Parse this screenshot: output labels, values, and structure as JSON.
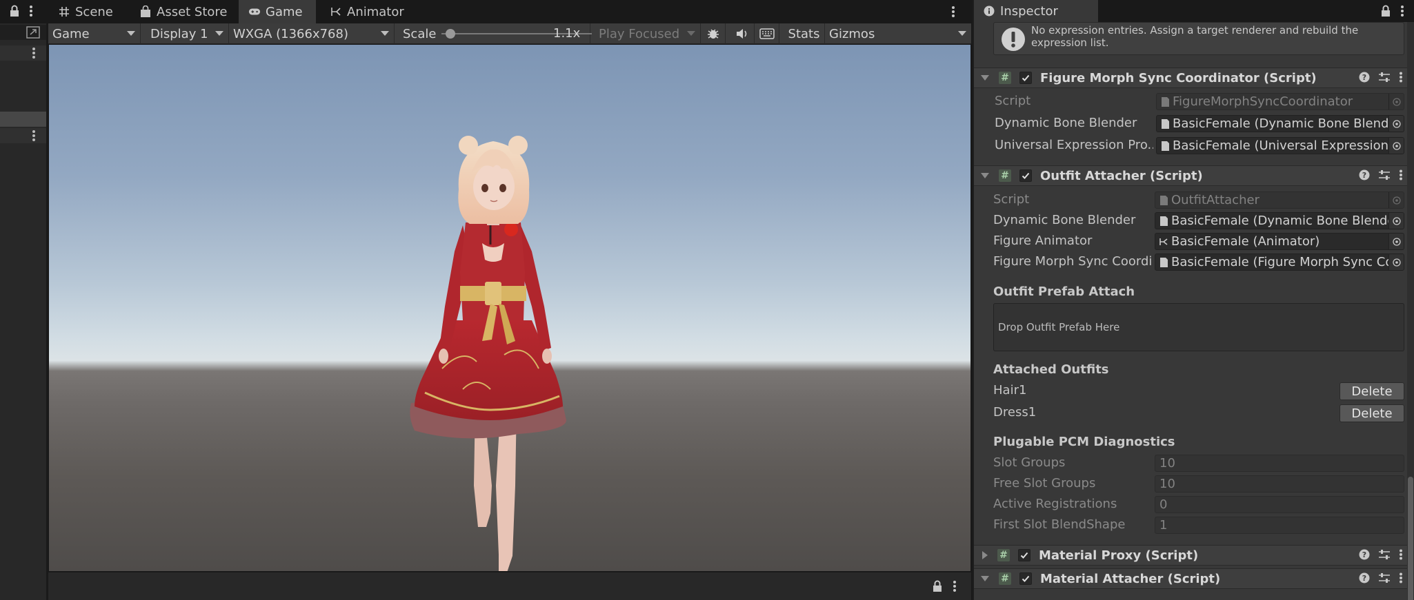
{
  "tabs": {
    "scene": "Scene",
    "asset_store": "Asset Store",
    "game": "Game",
    "animator": "Animator",
    "inspector": "Inspector"
  },
  "toolbar": {
    "view_mode": "Game",
    "display": "Display 1",
    "resolution": "WXGA (1366x768)",
    "scale_label": "Scale",
    "scale_value": "1.1x",
    "scale_fraction": 0.03,
    "play_mode": "Play Focused",
    "stats": "Stats",
    "gizmos": "Gizmos"
  },
  "inspector": {
    "help_text": "No expression entries. Assign a target renderer and rebuild the expression list.",
    "figure_morph": {
      "title": "Figure Morph Sync Coordinator (Script)",
      "rows": [
        {
          "label": "Script",
          "value": "FigureMorphSyncCoordinator"
        },
        {
          "label": "Dynamic Bone Blender",
          "value": "BasicFemale (Dynamic Bone Blender)"
        },
        {
          "label": "Universal Expression Pro...",
          "value": "BasicFemale (Universal Expression Pro)"
        }
      ]
    },
    "outfit_attacher": {
      "title": "Outfit Attacher (Script)",
      "rows": [
        {
          "label": "Script",
          "value": "OutfitAttacher"
        },
        {
          "label": "Dynamic Bone Blender",
          "value": "BasicFemale (Dynamic Bone Blender)"
        },
        {
          "label": "Figure Animator",
          "value": "BasicFemale (Animator)"
        },
        {
          "label": "Figure Morph Sync Coordin",
          "value": "BasicFemale (Figure Morph Sync Coordinator)"
        }
      ],
      "prefab_attach_title": "Outfit Prefab Attach",
      "drop_text": "Drop Outfit Prefab Here",
      "attached_title": "Attached Outfits",
      "attached": [
        {
          "name": "Hair1",
          "action": "Delete"
        },
        {
          "name": "Dress1",
          "action": "Delete"
        }
      ],
      "diagnostics_title": "Plugable PCM Diagnostics",
      "diagnostics": [
        {
          "label": "Slot Groups",
          "value": "10"
        },
        {
          "label": "Free Slot Groups",
          "value": "10"
        },
        {
          "label": "Active Registrations",
          "value": "0"
        },
        {
          "label": "First Slot BlendShape",
          "value": "1"
        }
      ]
    },
    "material_proxy": {
      "title": "Material Proxy (Script)"
    },
    "material_attacher": {
      "title": "Material Attacher (Script)"
    }
  },
  "colors": {
    "panel_bg": "#383838",
    "toolbar_bg": "#3c3c3c",
    "dark_bg": "#191919",
    "dress_red": "#b42a30",
    "gold": "#d8b564"
  }
}
